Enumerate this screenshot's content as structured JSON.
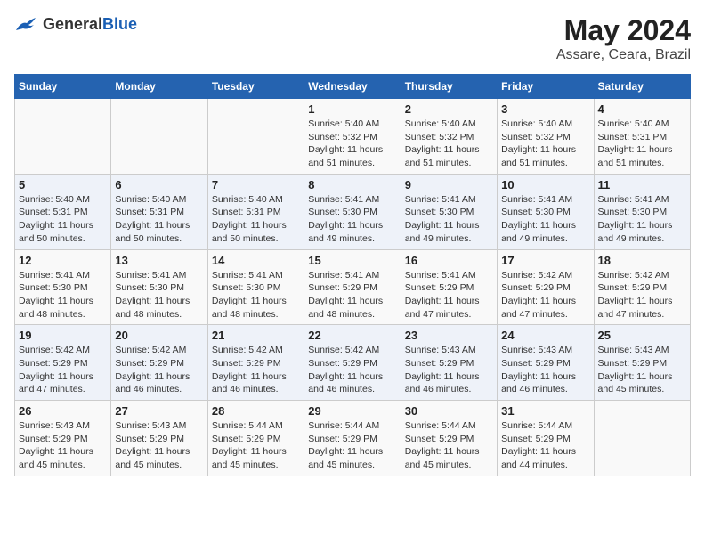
{
  "header": {
    "logo_general": "General",
    "logo_blue": "Blue",
    "title": "May 2024",
    "location": "Assare, Ceara, Brazil"
  },
  "weekdays": [
    "Sunday",
    "Monday",
    "Tuesday",
    "Wednesday",
    "Thursday",
    "Friday",
    "Saturday"
  ],
  "weeks": [
    [
      {
        "day": "",
        "sunrise": "",
        "sunset": "",
        "daylight": ""
      },
      {
        "day": "",
        "sunrise": "",
        "sunset": "",
        "daylight": ""
      },
      {
        "day": "",
        "sunrise": "",
        "sunset": "",
        "daylight": ""
      },
      {
        "day": "1",
        "sunrise": "Sunrise: 5:40 AM",
        "sunset": "Sunset: 5:32 PM",
        "daylight": "Daylight: 11 hours and 51 minutes."
      },
      {
        "day": "2",
        "sunrise": "Sunrise: 5:40 AM",
        "sunset": "Sunset: 5:32 PM",
        "daylight": "Daylight: 11 hours and 51 minutes."
      },
      {
        "day": "3",
        "sunrise": "Sunrise: 5:40 AM",
        "sunset": "Sunset: 5:32 PM",
        "daylight": "Daylight: 11 hours and 51 minutes."
      },
      {
        "day": "4",
        "sunrise": "Sunrise: 5:40 AM",
        "sunset": "Sunset: 5:31 PM",
        "daylight": "Daylight: 11 hours and 51 minutes."
      }
    ],
    [
      {
        "day": "5",
        "sunrise": "Sunrise: 5:40 AM",
        "sunset": "Sunset: 5:31 PM",
        "daylight": "Daylight: 11 hours and 50 minutes."
      },
      {
        "day": "6",
        "sunrise": "Sunrise: 5:40 AM",
        "sunset": "Sunset: 5:31 PM",
        "daylight": "Daylight: 11 hours and 50 minutes."
      },
      {
        "day": "7",
        "sunrise": "Sunrise: 5:40 AM",
        "sunset": "Sunset: 5:31 PM",
        "daylight": "Daylight: 11 hours and 50 minutes."
      },
      {
        "day": "8",
        "sunrise": "Sunrise: 5:41 AM",
        "sunset": "Sunset: 5:30 PM",
        "daylight": "Daylight: 11 hours and 49 minutes."
      },
      {
        "day": "9",
        "sunrise": "Sunrise: 5:41 AM",
        "sunset": "Sunset: 5:30 PM",
        "daylight": "Daylight: 11 hours and 49 minutes."
      },
      {
        "day": "10",
        "sunrise": "Sunrise: 5:41 AM",
        "sunset": "Sunset: 5:30 PM",
        "daylight": "Daylight: 11 hours and 49 minutes."
      },
      {
        "day": "11",
        "sunrise": "Sunrise: 5:41 AM",
        "sunset": "Sunset: 5:30 PM",
        "daylight": "Daylight: 11 hours and 49 minutes."
      }
    ],
    [
      {
        "day": "12",
        "sunrise": "Sunrise: 5:41 AM",
        "sunset": "Sunset: 5:30 PM",
        "daylight": "Daylight: 11 hours and 48 minutes."
      },
      {
        "day": "13",
        "sunrise": "Sunrise: 5:41 AM",
        "sunset": "Sunset: 5:30 PM",
        "daylight": "Daylight: 11 hours and 48 minutes."
      },
      {
        "day": "14",
        "sunrise": "Sunrise: 5:41 AM",
        "sunset": "Sunset: 5:30 PM",
        "daylight": "Daylight: 11 hours and 48 minutes."
      },
      {
        "day": "15",
        "sunrise": "Sunrise: 5:41 AM",
        "sunset": "Sunset: 5:29 PM",
        "daylight": "Daylight: 11 hours and 48 minutes."
      },
      {
        "day": "16",
        "sunrise": "Sunrise: 5:41 AM",
        "sunset": "Sunset: 5:29 PM",
        "daylight": "Daylight: 11 hours and 47 minutes."
      },
      {
        "day": "17",
        "sunrise": "Sunrise: 5:42 AM",
        "sunset": "Sunset: 5:29 PM",
        "daylight": "Daylight: 11 hours and 47 minutes."
      },
      {
        "day": "18",
        "sunrise": "Sunrise: 5:42 AM",
        "sunset": "Sunset: 5:29 PM",
        "daylight": "Daylight: 11 hours and 47 minutes."
      }
    ],
    [
      {
        "day": "19",
        "sunrise": "Sunrise: 5:42 AM",
        "sunset": "Sunset: 5:29 PM",
        "daylight": "Daylight: 11 hours and 47 minutes."
      },
      {
        "day": "20",
        "sunrise": "Sunrise: 5:42 AM",
        "sunset": "Sunset: 5:29 PM",
        "daylight": "Daylight: 11 hours and 46 minutes."
      },
      {
        "day": "21",
        "sunrise": "Sunrise: 5:42 AM",
        "sunset": "Sunset: 5:29 PM",
        "daylight": "Daylight: 11 hours and 46 minutes."
      },
      {
        "day": "22",
        "sunrise": "Sunrise: 5:42 AM",
        "sunset": "Sunset: 5:29 PM",
        "daylight": "Daylight: 11 hours and 46 minutes."
      },
      {
        "day": "23",
        "sunrise": "Sunrise: 5:43 AM",
        "sunset": "Sunset: 5:29 PM",
        "daylight": "Daylight: 11 hours and 46 minutes."
      },
      {
        "day": "24",
        "sunrise": "Sunrise: 5:43 AM",
        "sunset": "Sunset: 5:29 PM",
        "daylight": "Daylight: 11 hours and 46 minutes."
      },
      {
        "day": "25",
        "sunrise": "Sunrise: 5:43 AM",
        "sunset": "Sunset: 5:29 PM",
        "daylight": "Daylight: 11 hours and 45 minutes."
      }
    ],
    [
      {
        "day": "26",
        "sunrise": "Sunrise: 5:43 AM",
        "sunset": "Sunset: 5:29 PM",
        "daylight": "Daylight: 11 hours and 45 minutes."
      },
      {
        "day": "27",
        "sunrise": "Sunrise: 5:43 AM",
        "sunset": "Sunset: 5:29 PM",
        "daylight": "Daylight: 11 hours and 45 minutes."
      },
      {
        "day": "28",
        "sunrise": "Sunrise: 5:44 AM",
        "sunset": "Sunset: 5:29 PM",
        "daylight": "Daylight: 11 hours and 45 minutes."
      },
      {
        "day": "29",
        "sunrise": "Sunrise: 5:44 AM",
        "sunset": "Sunset: 5:29 PM",
        "daylight": "Daylight: 11 hours and 45 minutes."
      },
      {
        "day": "30",
        "sunrise": "Sunrise: 5:44 AM",
        "sunset": "Sunset: 5:29 PM",
        "daylight": "Daylight: 11 hours and 45 minutes."
      },
      {
        "day": "31",
        "sunrise": "Sunrise: 5:44 AM",
        "sunset": "Sunset: 5:29 PM",
        "daylight": "Daylight: 11 hours and 44 minutes."
      },
      {
        "day": "",
        "sunrise": "",
        "sunset": "",
        "daylight": ""
      }
    ]
  ]
}
